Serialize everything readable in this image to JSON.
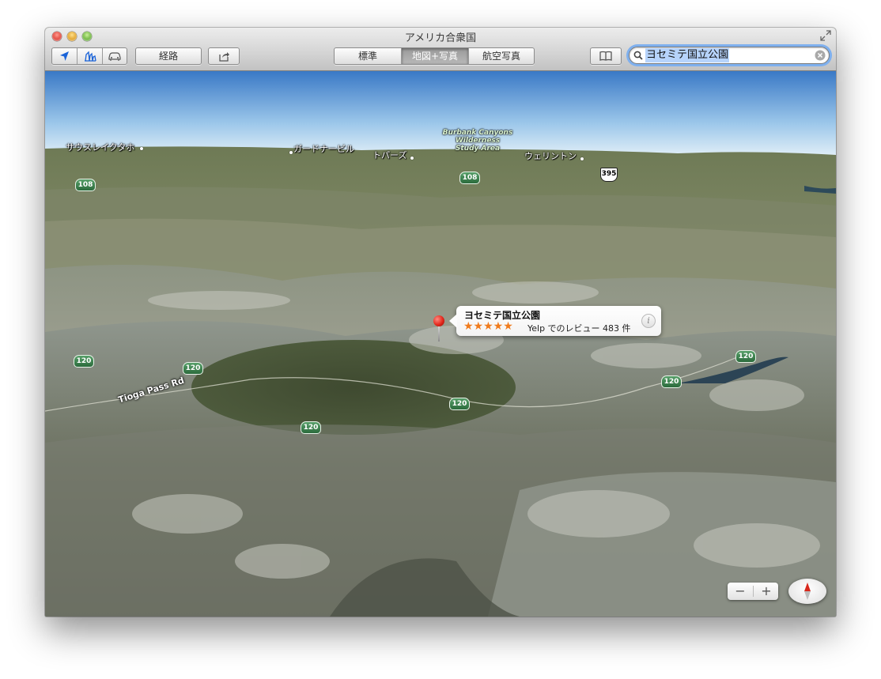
{
  "window": {
    "title": "アメリカ合衆国"
  },
  "toolbar": {
    "location_icon": "location-arrow-icon",
    "3d_icon": "3d-buildings-icon",
    "traffic_icon": "car-traffic-icon",
    "directions_label": "経路",
    "share_icon": "share-icon",
    "map_modes": [
      "標準",
      "地図+写真",
      "航空写真"
    ],
    "selected_mode": "地図+写真",
    "bookmarks_icon": "bookmarks-book-icon",
    "search_value": "ヨセミテ国立公園",
    "search_icon": "magnifier-icon",
    "clear_icon": "clear-x-icon"
  },
  "map": {
    "place_labels": [
      "サウスレイクタホ",
      "ガードナービル",
      "トパーズ",
      "ウェリントン"
    ],
    "wilderness_label": [
      "Burbank Canyons",
      "Wilderness",
      "Study Area"
    ],
    "road_label": "Tioga Pass Rd",
    "route_shields": [
      "108",
      "108",
      "120",
      "120",
      "120",
      "120",
      "120",
      "120"
    ],
    "us_route_shield": "395",
    "callout": {
      "title": "ヨセミテ国立公園",
      "rating": 5,
      "stars": "★★★★★",
      "review_text": "Yelp でのレビュー 483 件",
      "info_icon": "info-i-icon"
    },
    "zoom_out": "−",
    "zoom_in": "+",
    "compass_icon": "compass-needle-icon"
  }
}
